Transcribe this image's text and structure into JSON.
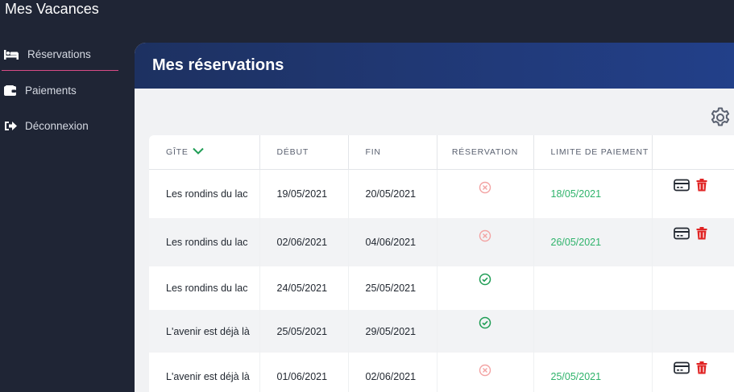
{
  "app": {
    "title": "Mes Vacances"
  },
  "sidebar": {
    "items": [
      {
        "label": "Réservations",
        "icon": "bed-icon"
      },
      {
        "label": "Paiements",
        "icon": "wallet-icon"
      },
      {
        "label": "Déconnexion",
        "icon": "logout-icon"
      }
    ]
  },
  "main": {
    "title": "Mes réservations",
    "settings_icon": "gear-icon"
  },
  "table": {
    "headers": [
      "Gîte",
      "Début",
      "Fin",
      "Réservation",
      "Limite de paiement",
      ""
    ],
    "rows": [
      {
        "gite": "Les rondins du lac",
        "debut": "19/05/2021",
        "fin": "20/05/2021",
        "reservation": "cancelled",
        "limite": "18/05/2021",
        "actions": true
      },
      {
        "gite": "Les rondins du lac",
        "debut": "02/06/2021",
        "fin": "04/06/2021",
        "reservation": "cancelled",
        "limite": "26/05/2021",
        "actions": true
      },
      {
        "gite": "Les rondins du lac",
        "debut": "24/05/2021",
        "fin": "25/05/2021",
        "reservation": "confirmed",
        "limite": "",
        "actions": false
      },
      {
        "gite": "L'avenir est déjà là",
        "debut": "25/05/2021",
        "fin": "29/05/2021",
        "reservation": "confirmed",
        "limite": "",
        "actions": false
      },
      {
        "gite": "L'avenir est déjà là",
        "debut": "01/06/2021",
        "fin": "02/06/2021",
        "reservation": "cancelled",
        "limite": "25/05/2021",
        "actions": true
      }
    ]
  },
  "colors": {
    "accent": "#d94c86",
    "confirmed": "#1f9d55",
    "cancelled": "#f3a3a3",
    "limit": "#2fb36b",
    "delete": "#e02424"
  }
}
